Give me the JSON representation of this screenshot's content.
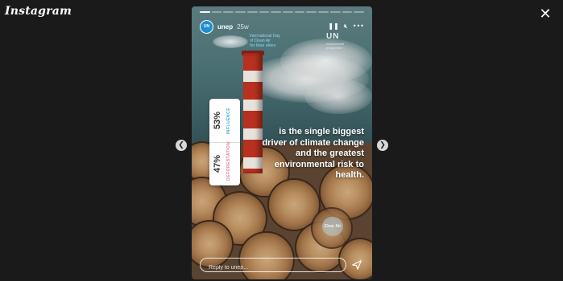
{
  "app": {
    "logo": "Instagram"
  },
  "story": {
    "progress_segments": 14,
    "progress_done": 1,
    "username": "unep",
    "time_ago": "25w",
    "avatar_text": "UN",
    "event_title_lines": [
      "International Day",
      "of Clean Air"
    ],
    "event_title_emph": "for blue skies",
    "org_mark": "UN",
    "org_sub_lines": [
      "environment",
      "programme"
    ],
    "poll": {
      "option_a": {
        "percent": "53%",
        "label": "INFLUENCE"
      },
      "option_b": {
        "percent": "47%",
        "label": "DEFORESTATION"
      }
    },
    "caption": "is the single biggest driver of climate change and the greatest environmental risk to health.",
    "stamp_text": "Clear Air"
  },
  "reply": {
    "placeholder": "Reply to unep..."
  },
  "icons": {
    "close": "close-icon",
    "prev": "chevron-left-icon",
    "next": "chevron-right-icon",
    "pause": "pause-icon",
    "mute": "mute-icon",
    "more": "more-icon",
    "send": "send-icon"
  }
}
